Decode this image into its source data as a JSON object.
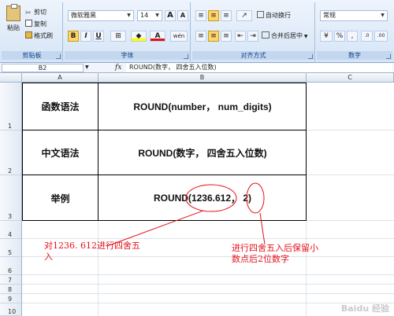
{
  "ribbon": {
    "clipboard": {
      "paste": "粘贴",
      "cut": "剪切",
      "copy": "复制",
      "format_painter": "格式刷",
      "group_label": "剪贴板"
    },
    "font": {
      "font_name": "微软雅黑",
      "font_size": "14",
      "group_label": "字体",
      "bold": "B",
      "italic": "I",
      "underline": "U",
      "grow": "A",
      "shrink": "A",
      "font_color": "A",
      "phonetic": "wén"
    },
    "alignment": {
      "wrap_text": "自动换行",
      "merge_center": "合并后居中",
      "group_label": "对齐方式"
    },
    "number": {
      "format": "常规",
      "percent": "%",
      "comma": ",",
      "inc_decimal": ".0",
      "dec_decimal": ".00",
      "currency": "¥",
      "group_label": "数字"
    }
  },
  "formula_bar": {
    "name_box": "B2",
    "fx": "fx",
    "content": "ROUND(数字， 四舍五入位数)"
  },
  "columns": [
    "A",
    "B",
    "C"
  ],
  "rows": [
    "1",
    "2",
    "3",
    "4",
    "5",
    "6",
    "7",
    "8",
    "9",
    "10"
  ],
  "table": {
    "r1": {
      "a": "函数语法",
      "b": "ROUND(number， num_digits)"
    },
    "r2": {
      "a": "中文语法",
      "b": "ROUND(数字， 四舍五入位数)"
    },
    "r3": {
      "a": "举例",
      "b_prefix": "ROUND(",
      "b_number": "1236.612",
      "b_sep": "，",
      "b_digits": "2",
      "b_suffix": ")"
    }
  },
  "annotations": {
    "left_line1": "对1236. 612进行四舍五",
    "left_line2": "入",
    "right_line1": "进行四舍五入后保留小",
    "right_line2": "数点后2位数字",
    "color": "#e4101a"
  },
  "watermark": "Baidu 经验"
}
